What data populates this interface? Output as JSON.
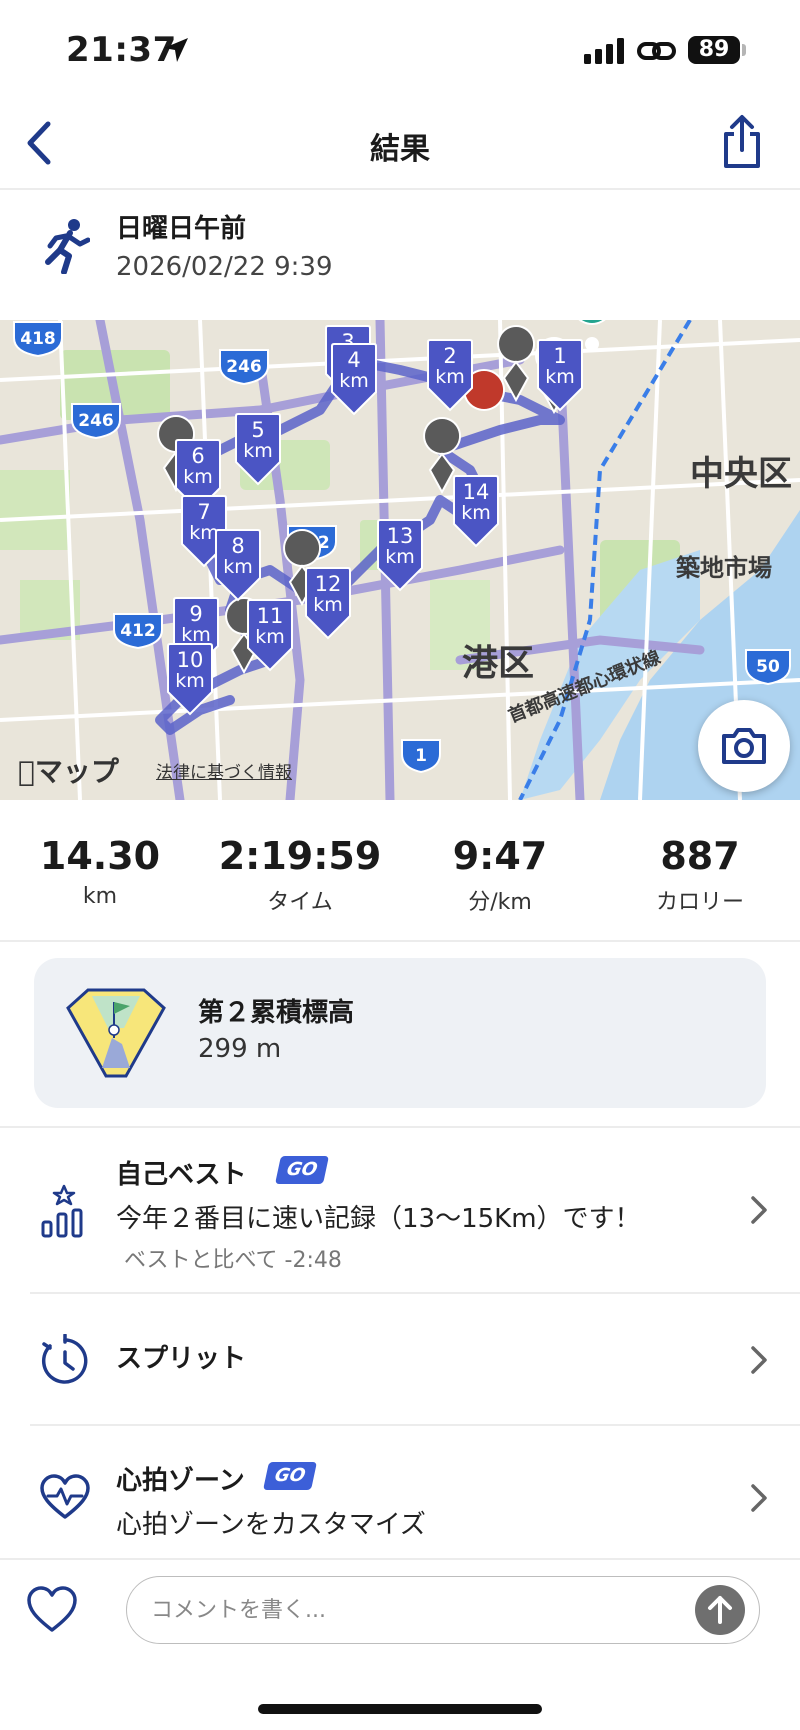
{
  "status": {
    "time": "21:37",
    "battery": "89"
  },
  "nav": {
    "title": "結果"
  },
  "activity": {
    "name": "日曜日午前",
    "datetime": "2026/02/22 9:39"
  },
  "map": {
    "labels": {
      "ward_minato": "港区",
      "ward_chuo": "中央区",
      "tsukiji": "築地市場",
      "expressway": "首都高速都心環状線"
    },
    "route_shields": [
      "418",
      "246",
      "246",
      "412",
      "412",
      "50",
      "1"
    ],
    "km_markers": [
      "1",
      "2",
      "3",
      "4",
      "5",
      "6",
      "7",
      "8",
      "9",
      "10",
      "11",
      "12",
      "13",
      "14"
    ],
    "km_unit": "km",
    "apple_maps": "マップ",
    "legal": "法律に基づく情報"
  },
  "stats": [
    {
      "value": "14.30",
      "label": "km"
    },
    {
      "value": "2:19:59",
      "label": "タイム"
    },
    {
      "value": "9:47",
      "label": "分/km"
    },
    {
      "value": "887",
      "label": "カロリー"
    }
  ],
  "badge": {
    "title": "第２累積標高",
    "value": "299 m"
  },
  "personal_best": {
    "title": "自己ベスト",
    "go": "GO",
    "text": "今年２番目に速い記録（13～15Km）です！",
    "sub": "ベストと比べて -2:48"
  },
  "splits": {
    "title": "スプリット"
  },
  "heart_zone": {
    "title": "心拍ゾーン",
    "go": "GO",
    "text": "心拍ゾーンをカスタマイズ"
  },
  "comment": {
    "placeholder": "コメントを書く..."
  },
  "colors": {
    "accent": "#1f3a8a",
    "route": "#5a63c9",
    "marker": "#4b55c4",
    "go": "#3c5fd8"
  }
}
